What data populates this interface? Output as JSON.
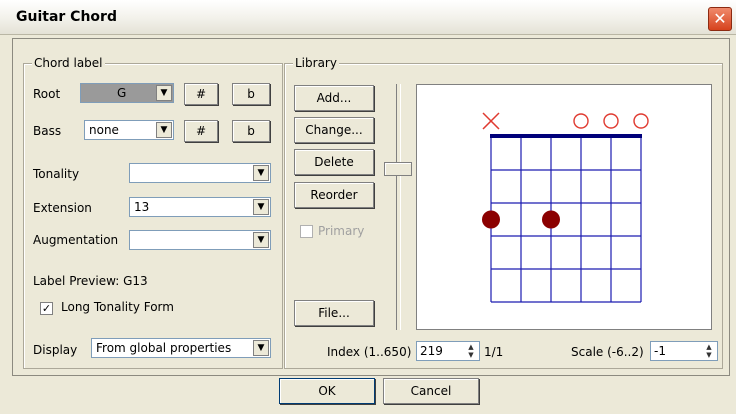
{
  "window": {
    "title": "Guitar Chord"
  },
  "chord_label": {
    "legend": "Chord label",
    "root_label": "Root",
    "root_value": "G",
    "sharp": "#",
    "flat": "b",
    "bass_label": "Bass",
    "bass_value": "none",
    "tonality_label": "Tonality",
    "tonality_value": "",
    "extension_label": "Extension",
    "extension_value": "13",
    "augmentation_label": "Augmentation",
    "augmentation_value": "",
    "preview": "Label Preview: G13",
    "long_tonality_label": "Long Tonality Form",
    "long_tonality_checked": true,
    "display_label": "Display",
    "display_value": "From global properties"
  },
  "library": {
    "legend": "Library",
    "add": "Add...",
    "change": "Change...",
    "delete": "Delete",
    "reorder": "Reorder",
    "primary_label": "Primary",
    "primary_checked": false,
    "file": "File...",
    "index_label": "Index (1..650)",
    "index_value": "219",
    "index_page": "1/1",
    "scale_label": "Scale (-6..2)",
    "scale_value": "-1"
  },
  "chord_diagram": {
    "strings": 6,
    "frets": 5,
    "string_markers": [
      "x",
      "",
      "",
      "o",
      "o",
      "o"
    ],
    "dots": [
      {
        "string": 1,
        "fret": 3
      },
      {
        "string": 3,
        "fret": 3
      }
    ],
    "colors": {
      "grid": "#1c1cb0",
      "nut": "#00007a",
      "dot": "#8b0000",
      "marker": "#e03a30"
    }
  },
  "dialog": {
    "ok": "OK",
    "cancel": "Cancel"
  }
}
